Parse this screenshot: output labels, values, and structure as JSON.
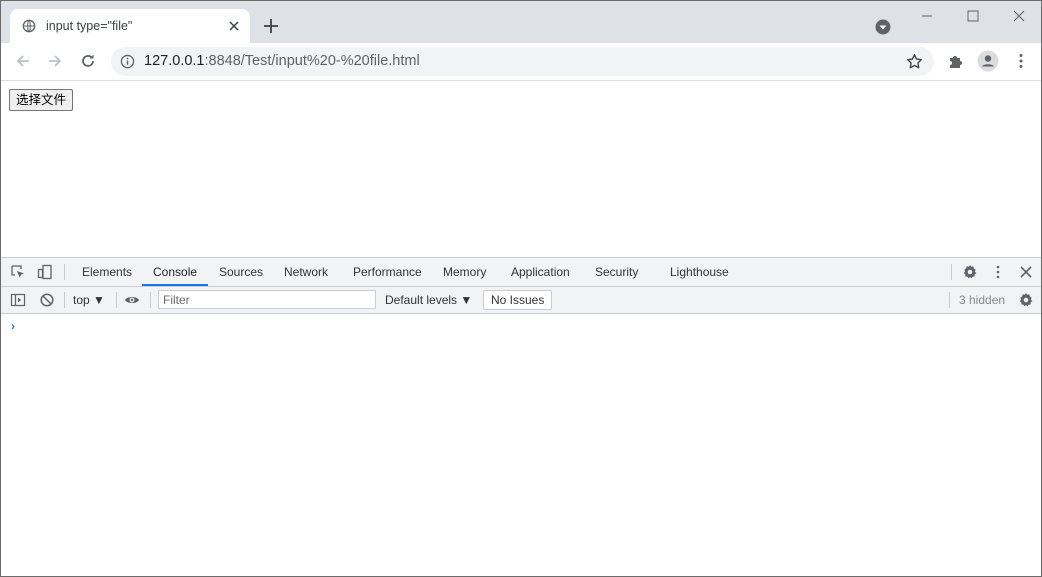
{
  "browser": {
    "tab": {
      "title": "input type=\"file\"",
      "favicon": "globe-icon"
    },
    "address": {
      "host": "127.0.0.1",
      "rest": ":8848/Test/input%20-%20file.html"
    }
  },
  "page": {
    "file_input": {
      "button_label": "选择文件"
    }
  },
  "devtools": {
    "tabs": [
      "Elements",
      "Console",
      "Sources",
      "Network",
      "Performance",
      "Memory",
      "Application",
      "Security",
      "Lighthouse"
    ],
    "active_tab": "Console",
    "console": {
      "context": "top",
      "filter_placeholder": "Filter",
      "levels": "Default levels",
      "issues": "No Issues",
      "hidden": "3 hidden",
      "prompt": "›"
    }
  },
  "colors": {
    "accent": "#1a73e8",
    "tabstrip": "#dee1e6",
    "toolbar_bg": "#f1f3f4"
  }
}
